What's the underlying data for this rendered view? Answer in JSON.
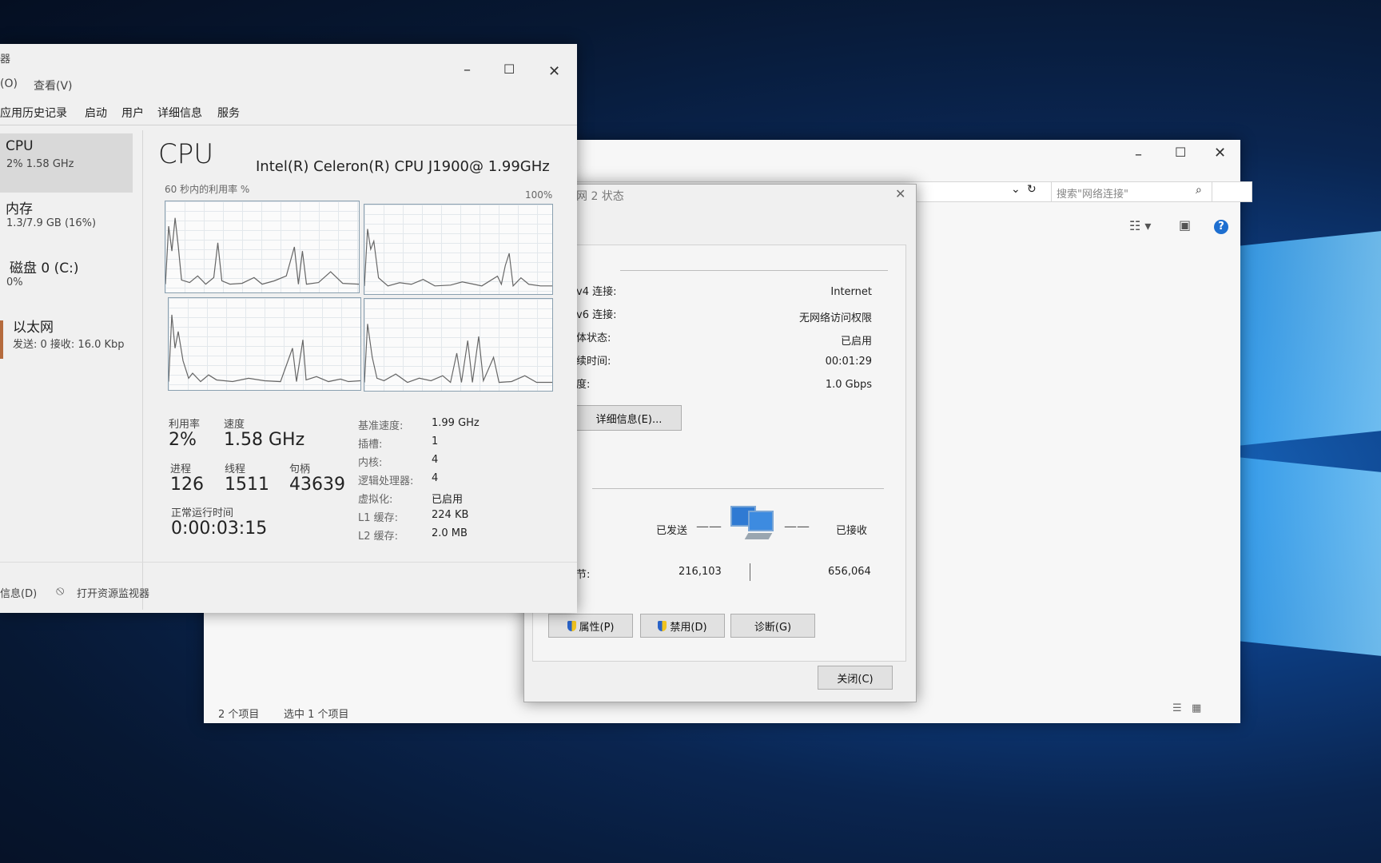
{
  "task_manager": {
    "title_fragment": "器",
    "menu": [
      "(O)",
      "查看(V)"
    ],
    "tabs": [
      "应用历史记录",
      "启动",
      "用户",
      "详细信息",
      "服务"
    ],
    "side": [
      {
        "name": "CPU",
        "sub": "2% 1.58 GHz"
      },
      {
        "name": "内存",
        "sub": "1.3/7.9 GB (16%)"
      },
      {
        "name": "磁盘 0 (C:)",
        "sub": "0%"
      },
      {
        "name": "以太网",
        "sub": "发送: 0 接收: 16.0 Kbp"
      }
    ],
    "heading": "CPU",
    "cpu_model": "Intel(R) Celeron(R) CPU J1900@ 1.99GHz",
    "graph_caption": "60 秒内的利用率 %",
    "graph_max": "100%",
    "stats": {
      "util_label": "利用率",
      "util_value": "2%",
      "speed_label": "速度",
      "speed_value": "1.58 GHz",
      "proc_label": "进程",
      "proc_value": "126",
      "thread_label": "线程",
      "thread_value": "1511",
      "handle_label": "句柄",
      "handle_value": "43639",
      "uptime_label": "正常运行时间",
      "uptime_value": "0:00:03:15"
    },
    "specs": [
      {
        "k": "基准速度:",
        "v": "1.99 GHz"
      },
      {
        "k": "插槽:",
        "v": "1"
      },
      {
        "k": "内核:",
        "v": "4"
      },
      {
        "k": "逻辑处理器:",
        "v": "4"
      },
      {
        "k": "虚拟化:",
        "v": "已启用"
      },
      {
        "k": "L1 缓存:",
        "v": "224 KB"
      },
      {
        "k": "L2 缓存:",
        "v": "2.0 MB"
      }
    ],
    "footer_less": "信息(D)",
    "footer_monitor": "打开资源监视器"
  },
  "explorer": {
    "search_placeholder": "搜索\"网络连接\"",
    "status_items": "2 个项目",
    "status_selected": "选中 1 个项目"
  },
  "dialog": {
    "title": "网 2 状态",
    "rows": [
      {
        "k": "v4 连接:",
        "v": "Internet"
      },
      {
        "k": "v6 连接:",
        "v": "无网络访问权限"
      },
      {
        "k": "体状态:",
        "v": "已启用"
      },
      {
        "k": "续时间:",
        "v": "00:01:29"
      },
      {
        "k": "度:",
        "v": "1.0 Gbps"
      }
    ],
    "details_btn": "详细信息(E)...",
    "sent_label": "已发送",
    "recv_label": "已接收",
    "bytes_label": "节:",
    "bytes_sent": "216,103",
    "bytes_recv": "656,064",
    "properties_btn": "属性(P)",
    "disable_btn": "禁用(D)",
    "diagnose_btn": "诊断(G)",
    "close_btn": "关闭(C)"
  }
}
